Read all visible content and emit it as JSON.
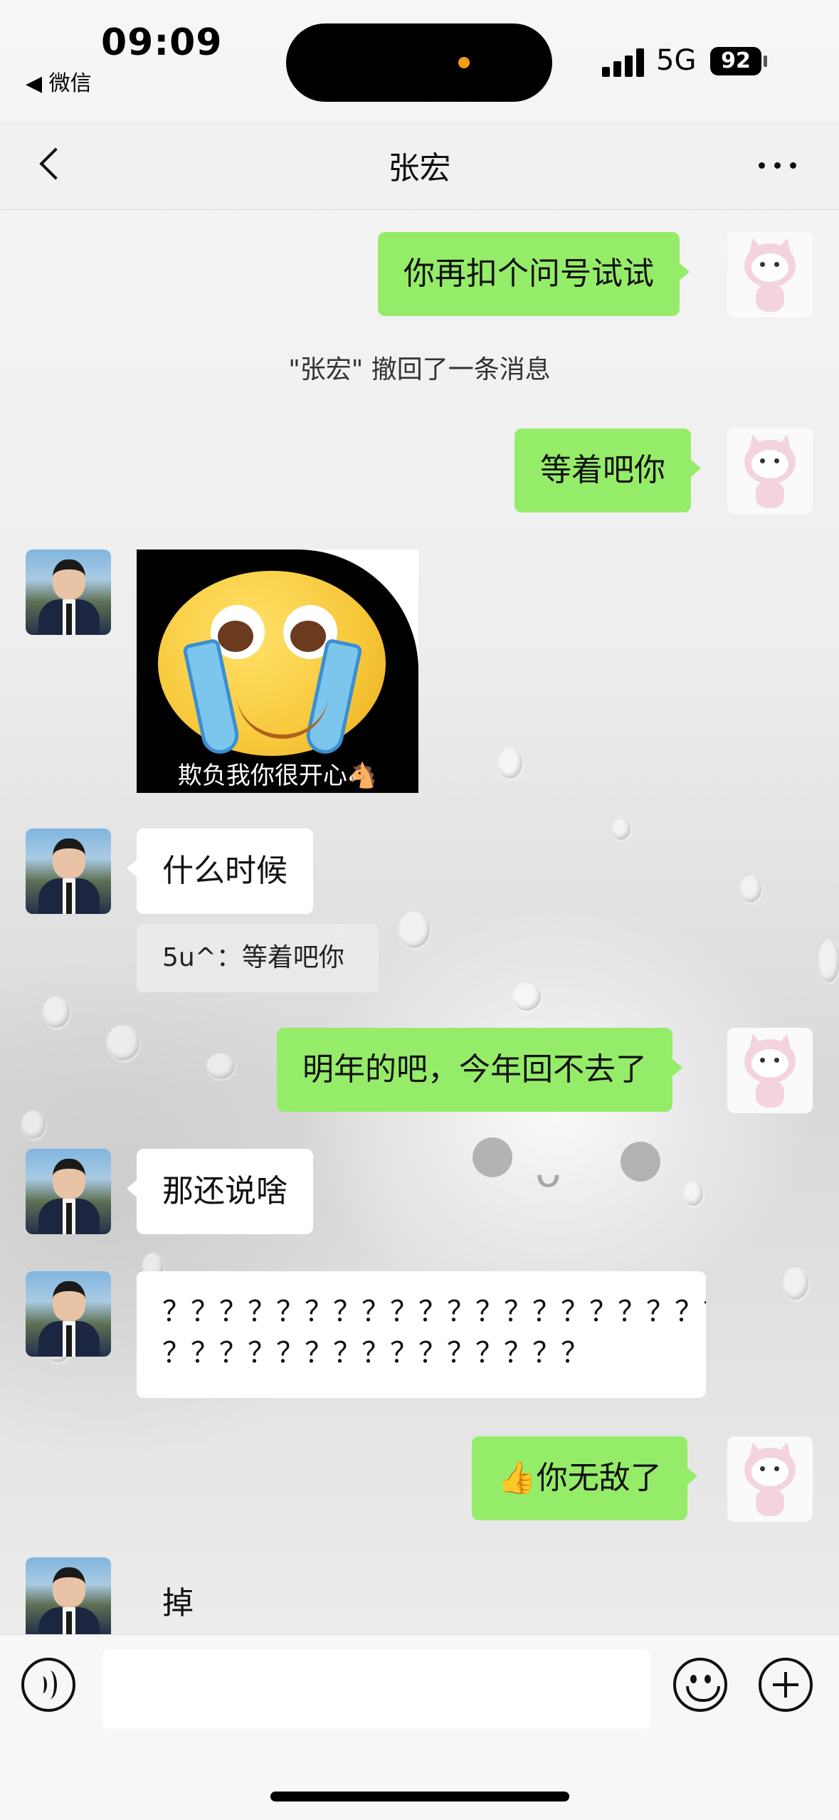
{
  "status_bar": {
    "time": "09:09",
    "back_app": "◀ 微信",
    "network": "5G",
    "battery": "92"
  },
  "nav": {
    "title": "张宏",
    "back_icon": "chevron-left-icon",
    "more_icon": "more-dots-icon"
  },
  "messages": [
    {
      "sender": "me",
      "type": "text",
      "text": "你再扣个问号试试"
    },
    {
      "type": "system",
      "text": "\"张宏\" 撤回了一条消息"
    },
    {
      "sender": "me",
      "type": "text",
      "text": "等着吧你"
    },
    {
      "sender": "other",
      "type": "sticker",
      "caption": "欺负我你很开心🐴"
    },
    {
      "sender": "other",
      "type": "text",
      "text": "什么时候",
      "quote": "5u^：等着吧你"
    },
    {
      "sender": "me",
      "type": "text",
      "text": "明年的吧，今年回不去了"
    },
    {
      "sender": "other",
      "type": "text",
      "text": "那还说啥"
    },
    {
      "sender": "other",
      "type": "text",
      "lines": [
        "？？？？？？？？？？？？？？？？？？？？？",
        "？？？？？？？？？？？？？？？"
      ]
    },
    {
      "sender": "me",
      "type": "text",
      "text": "👍你无敌了"
    },
    {
      "sender": "other",
      "type": "text",
      "text": "掉"
    }
  ],
  "input_bar": {
    "voice_icon": "voice-icon",
    "emoji_icon": "emoji-icon",
    "plus_icon": "plus-icon",
    "text_value": ""
  },
  "colors": {
    "my_bubble": "#95ec69",
    "other_bubble": "#ffffff",
    "battery_badge": "#000000"
  }
}
